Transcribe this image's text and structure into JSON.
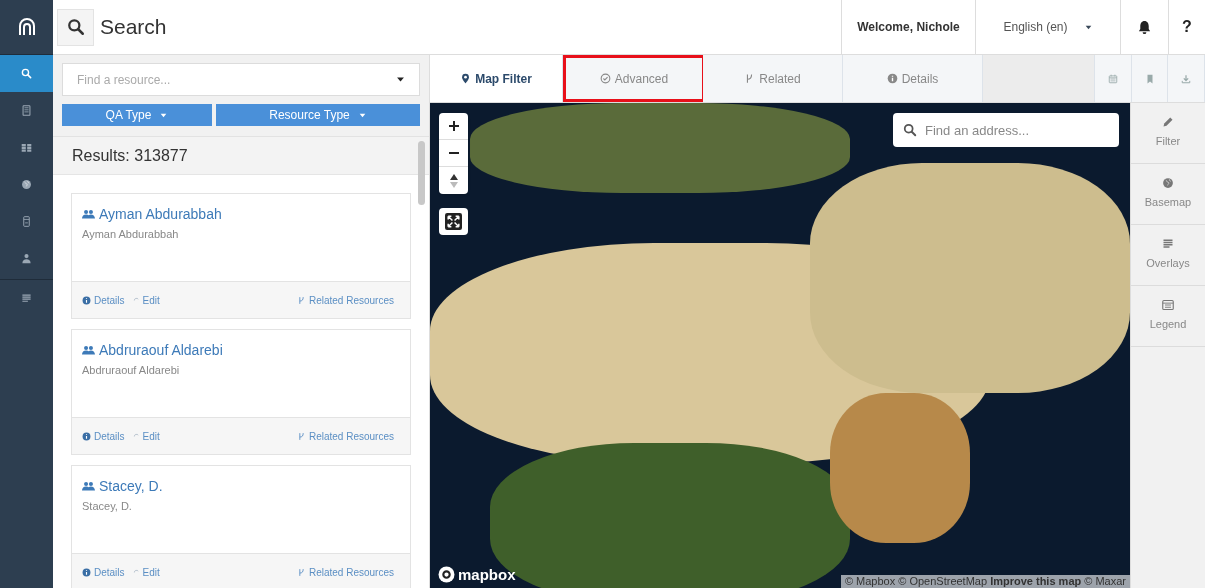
{
  "nav": {
    "items": [
      {
        "kind": "search",
        "selected": true
      },
      {
        "kind": "report",
        "selected": false
      },
      {
        "kind": "grid",
        "selected": false
      },
      {
        "kind": "globe",
        "selected": false
      },
      {
        "kind": "card",
        "selected": false
      },
      {
        "kind": "user",
        "selected": false
      },
      {
        "kind": "list",
        "selected": false
      }
    ]
  },
  "header": {
    "title": "Search",
    "welcome": "Welcome, Nichole",
    "language": "English (en)",
    "help": "?"
  },
  "search_panel": {
    "placeholder": "Find a resource...",
    "filters": [
      "QA Type",
      "Resource Type"
    ],
    "results": "Results: 313877",
    "cards": [
      {
        "title": "Ayman Abdurabbah",
        "subtitle": "Ayman Abdurabbah",
        "details": "Details",
        "edit": "Edit",
        "related": "Related Resources"
      },
      {
        "title": "Abdruraouf Aldarebi",
        "subtitle": "Abdruraouf Aldarebi",
        "details": "Details",
        "edit": "Edit",
        "related": "Related Resources"
      },
      {
        "title": "Stacey, D.",
        "subtitle": "Stacey, D.",
        "details": "Details",
        "edit": "Edit",
        "related": "Related Resources"
      }
    ]
  },
  "tabs": [
    {
      "label": "Map Filter",
      "kind": "pin",
      "selected": true,
      "highlighted": false
    },
    {
      "label": "Advanced",
      "kind": "check",
      "selected": false,
      "highlighted": true
    },
    {
      "label": "Related",
      "kind": "branch",
      "selected": false,
      "highlighted": false
    },
    {
      "label": "Details",
      "kind": "info",
      "selected": false,
      "highlighted": false
    }
  ],
  "tab_tools": [
    {
      "kind": "calendar"
    },
    {
      "kind": "bookmark"
    },
    {
      "kind": "download"
    }
  ],
  "map": {
    "address_placeholder": "Find an address...",
    "logo": "mapbox",
    "attribution": "© Mapbox © OpenStreetMap **Improve this map** © Maxar"
  },
  "tools": [
    {
      "label": "Filter",
      "kind": "pencil"
    },
    {
      "label": "Basemap",
      "kind": "globe"
    },
    {
      "label": "Overlays",
      "kind": "list"
    },
    {
      "label": "Legend",
      "kind": "legend"
    }
  ]
}
